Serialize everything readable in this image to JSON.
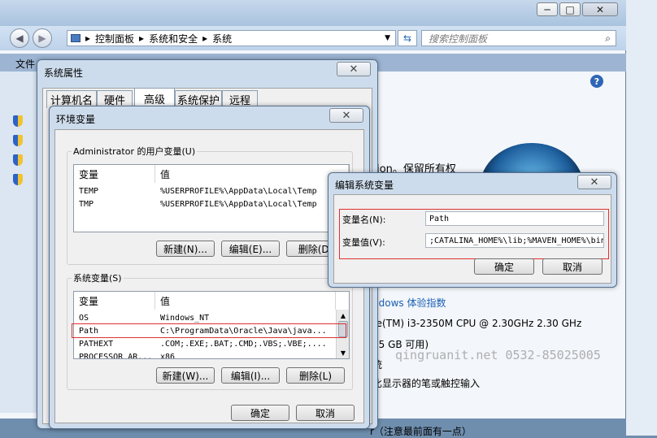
{
  "cp": {
    "breadcrumb": [
      "控制面板",
      "系统和安全",
      "系统"
    ],
    "search_placeholder": "搜索控制面板",
    "file_menu": "文件",
    "help_icon": "?",
    "copyright": "tion。保留所有权",
    "rating_link": "ndows 体验指数",
    "cpu": "re(TM) i3-2350M CPU @ 2.30GHz   2.30 GHz",
    "ram": "95 GB 可用)",
    "system_type": "统",
    "pen": "比显示器的笔或触控输入",
    "bottom_note": "r（注意最前面有一点）",
    "title_controls": [
      "─",
      "□",
      "✕"
    ]
  },
  "sysprops": {
    "title": "系统属性",
    "close": "✕",
    "tabs": [
      "计算机名",
      "硬件",
      "高级",
      "系统保护",
      "远程"
    ]
  },
  "envvars": {
    "title": "环境变量",
    "close": "✕",
    "user_group": "Administrator 的用户变量(U)",
    "col_var": "变量",
    "col_val": "值",
    "user_rows": [
      {
        "name": "TEMP",
        "value": "%USERPROFILE%\\AppData\\Local\\Temp"
      },
      {
        "name": "TMP",
        "value": "%USERPROFILE%\\AppData\\Local\\Temp"
      }
    ],
    "user_buttons": {
      "new": "新建(N)...",
      "edit": "编辑(E)...",
      "delete": "删除(D)"
    },
    "sys_group": "系统变量(S)",
    "sys_rows": [
      {
        "name": "OS",
        "value": "Windows_NT"
      },
      {
        "name": "Path",
        "value": "C:\\ProgramData\\Oracle\\Java\\java..."
      },
      {
        "name": "PATHEXT",
        "value": ".COM;.EXE;.BAT;.CMD;.VBS;.VBE;...."
      },
      {
        "name": "PROCESSOR_AR...",
        "value": "x86"
      }
    ],
    "sys_buttons": {
      "new": "新建(W)...",
      "edit": "编辑(I)...",
      "delete": "删除(L)"
    },
    "ok": "确定",
    "cancel": "取消"
  },
  "edit": {
    "title": "编辑系统变量",
    "close": "✕",
    "name_label": "变量名(N):",
    "name_value": "Path",
    "value_label": "变量值(V):",
    "value_value": ";CATALINA_HOME%\\lib;%MAVEN_HOME%\\bin",
    "ok": "确定",
    "cancel": "取消"
  },
  "watermark": "qingruanit.net 0532-85025005",
  "colors": {
    "highlight_box": "#e03030",
    "link": "#1a5fb4",
    "frame": "#cddcec"
  }
}
